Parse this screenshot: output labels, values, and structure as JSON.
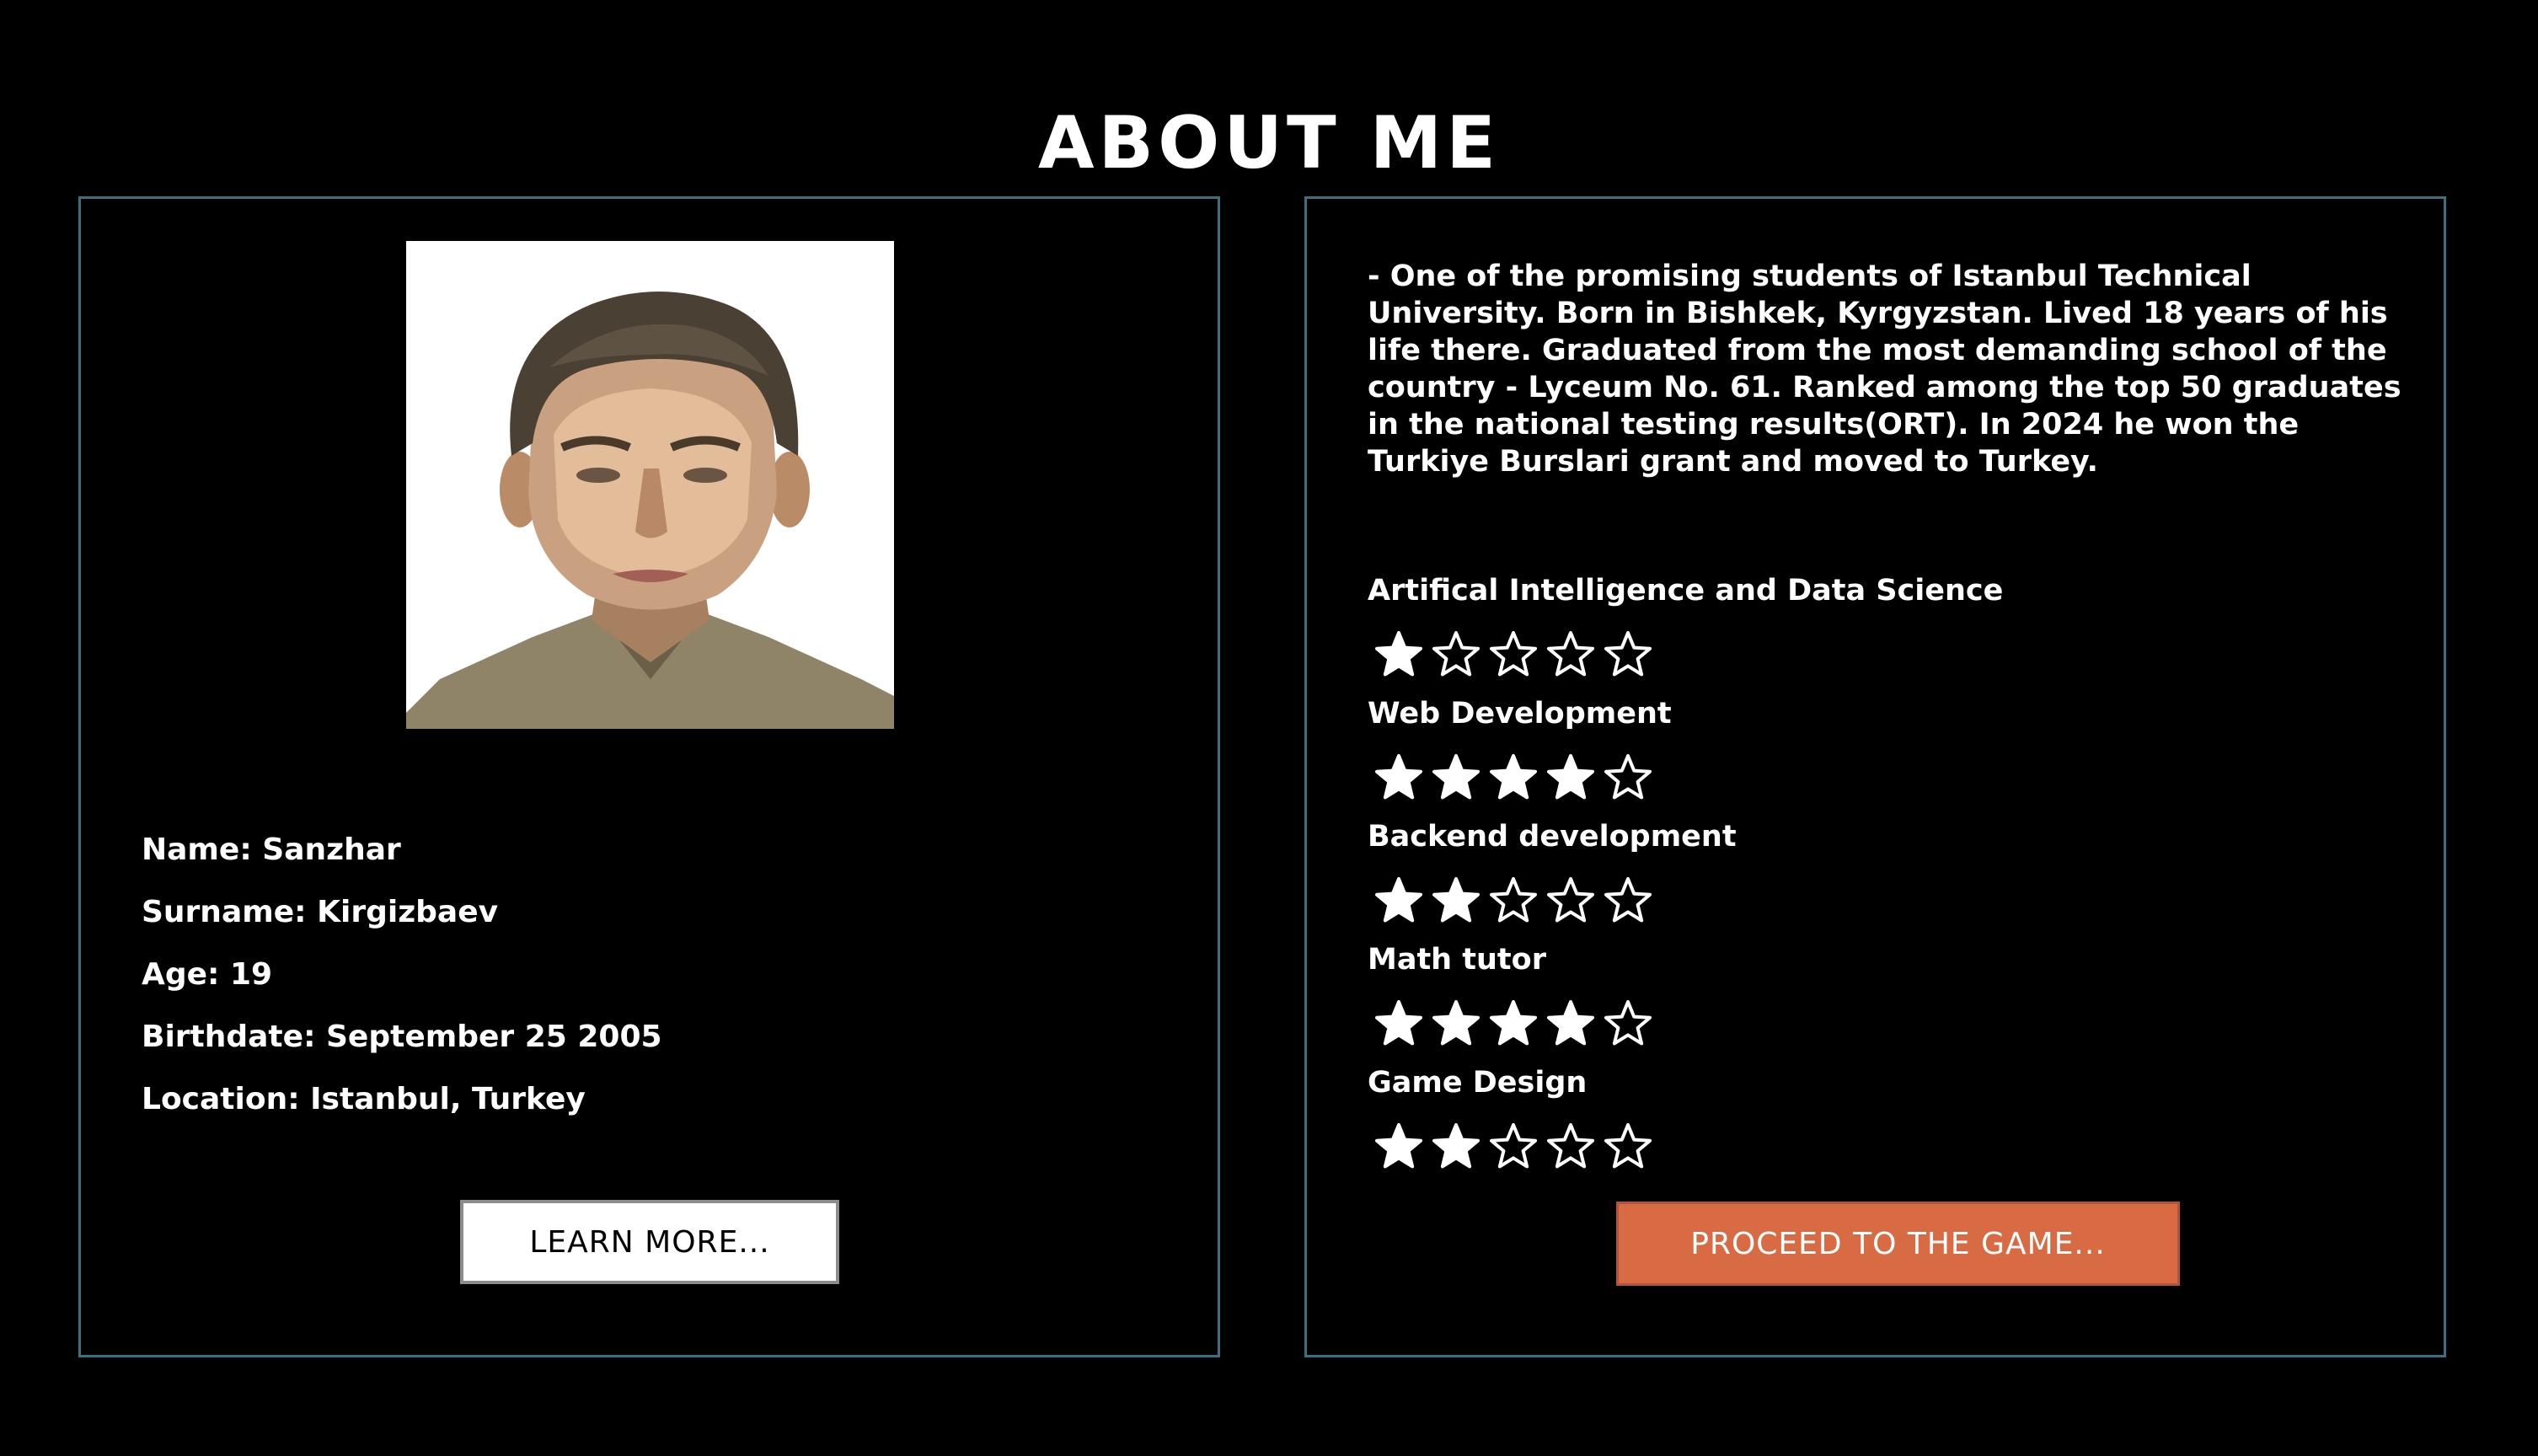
{
  "page": {
    "title": "ABOUT ME"
  },
  "profile": {
    "info": [
      {
        "label": "Name",
        "value": "Sanzhar"
      },
      {
        "label": "Surname",
        "value": "Kirgizbaev"
      },
      {
        "label": "Age",
        "value": "19"
      },
      {
        "label": "Birthdate",
        "value": "September 25 2005"
      },
      {
        "label": "Location",
        "value": "Istanbul, Turkey"
      }
    ],
    "learn_more_label": "LEARN MORE..."
  },
  "about": {
    "bio": "- One of the promising students of Istanbul Technical University. Born in Bishkek, Kyrgyzstan. Lived 18 years of his life there. Graduated from the most demanding school of the country - Lyceum No. 61. Ranked among the top 50 graduates in the national testing results(ORT). In 2024 he won the Turkiye Burslari grant and moved to Turkey.",
    "skills": [
      {
        "name": "Artifical Intelligence and Data Science",
        "rating": 1,
        "max": 5
      },
      {
        "name": "Web Development",
        "rating": 4,
        "max": 5
      },
      {
        "name": "Backend development",
        "rating": 2,
        "max": 5
      },
      {
        "name": "Math tutor",
        "rating": 4,
        "max": 5
      },
      {
        "name": "Game Design",
        "rating": 2,
        "max": 5
      }
    ],
    "proceed_label": "PROCEED TO THE GAME..."
  },
  "icons": {
    "star_filled": "star-filled-icon",
    "star_empty": "star-empty-icon"
  },
  "colors": {
    "background": "#000000",
    "panel_border": "#3c6f80",
    "text": "#ffffff",
    "proceed_button": "#d86a44",
    "learn_button": "#ffffff"
  }
}
